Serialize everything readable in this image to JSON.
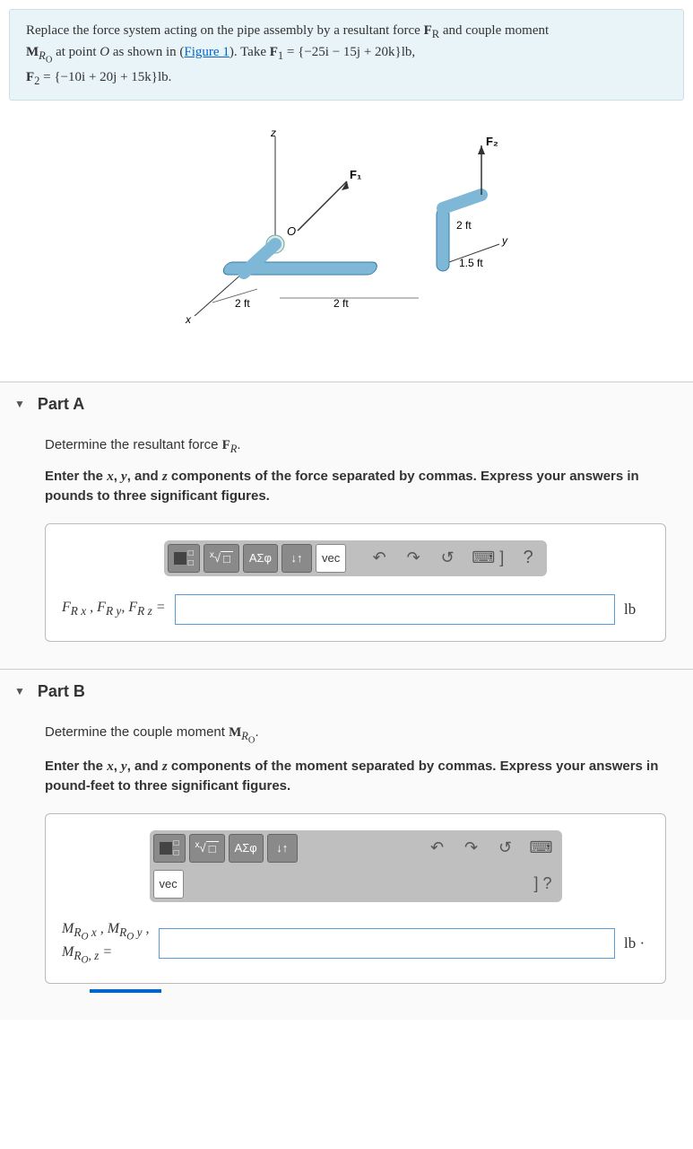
{
  "problem": {
    "line1_prefix": "Replace the force system acting on the pipe assembly by a resultant force ",
    "line1_fr": "F",
    "line1_frsub": "R",
    "line1_mid": " and couple moment ",
    "line2_m": "M",
    "line2_msub": "R",
    "line2_msub2": "O",
    "line2_mid": " at point ",
    "line2_O": "O",
    "line2_shown": " as shown in (",
    "figure_link": "Figure 1",
    "line2_take": "). Take ",
    "f1_label": "F",
    "f1_sub": "1",
    "f1_eq": " = {−25i − 15j + 20k}lb,",
    "f2_label": "F",
    "f2_sub": "2",
    "f2_eq": " = {−10i + 20j + 15k}lb."
  },
  "figure": {
    "z": "z",
    "x": "x",
    "y": "y",
    "O": "O",
    "F1": "F₁",
    "F2": "F₂",
    "d2ft_a": "2 ft",
    "d2ft_b": "2 ft",
    "d2ft_c": "2 ft",
    "d15ft": "1.5 ft"
  },
  "partA": {
    "title": "Part A",
    "prompt_pre": "Determine the resultant force ",
    "prompt_sym": "F",
    "prompt_sub": "R",
    "prompt_post": ".",
    "instruction": "Enter the x, y, and z components of the force separated by commas. Express your answers in pounds to three significant figures.",
    "label_html": "F<sub>R x</sub> , F<sub>R y</sub>, F<sub>R z</sub> =",
    "unit": "lb"
  },
  "partB": {
    "title": "Part B",
    "prompt_pre": "Determine the couple moment ",
    "prompt_sym": "M",
    "prompt_sub": "R",
    "prompt_sub2": "O",
    "prompt_post": ".",
    "instruction": "Enter the x, y, and z components of the moment separated by commas. Express your answers in pound-feet to three significant figures.",
    "label_line1": "M<sub>R<sub>O</sub> x</sub> , M<sub>R<sub>O</sub> y</sub> ,",
    "label_line2": "M<sub>R<sub>O</sub>, z</sub> =",
    "unit": "lb ·"
  },
  "toolbar": {
    "templates": "",
    "sqrt": "√",
    "greek": "ΑΣφ",
    "arrows": "↓↑",
    "vec": "vec",
    "undo": "↶",
    "redo": "↷",
    "reset": "↺",
    "keyboard": "⌨ ]",
    "help": "?",
    "help2": "] ?"
  }
}
